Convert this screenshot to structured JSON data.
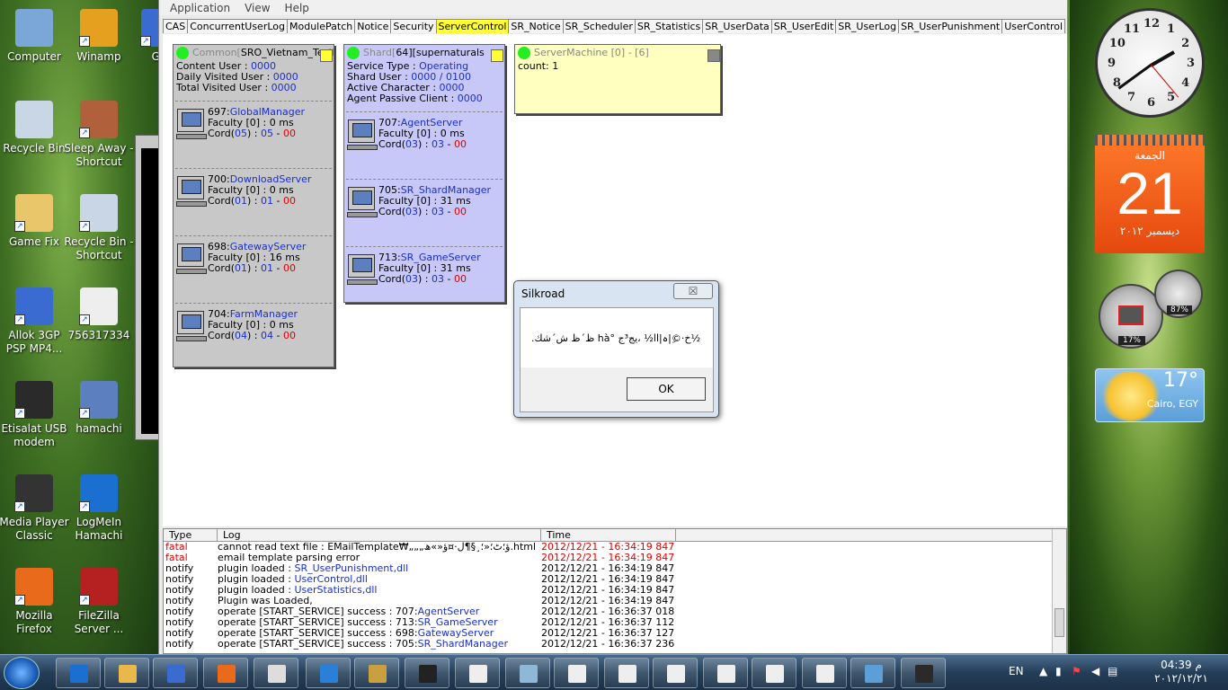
{
  "desktop": {
    "icons": [
      {
        "label": "Computer",
        "color": "#7aa7d8",
        "x": 0
      },
      {
        "label": "Winamp",
        "color": "#e5a020",
        "x": 0
      },
      {
        "label": "GO",
        "color": "#3a6bd0",
        "x": 0
      },
      {
        "label": "Recycle Bin",
        "color": "#c9d6e6",
        "x": 0
      },
      {
        "label": "Sleep Away - Shortcut",
        "color": "#b0603a",
        "x": 0
      },
      {
        "label": "Game Fix",
        "color": "#e9c66a",
        "x": 0
      },
      {
        "label": "Recycle Bin - Shortcut",
        "color": "#c9d6e6",
        "x": 0
      },
      {
        "label": "Allok 3GP PSP MP4...",
        "color": "#3a6bd0",
        "x": 0
      },
      {
        "label": "756317334",
        "color": "#eeeeee",
        "x": 0
      },
      {
        "label": "Etisalat USB modem",
        "color": "#2a2a2a",
        "x": 0
      },
      {
        "label": "hamachi",
        "color": "#5b7fbf",
        "x": 0
      },
      {
        "label": "Media Player Classic",
        "color": "#333333",
        "x": 0
      },
      {
        "label": "LogMeIn Hamachi",
        "color": "#1a6fd0",
        "x": 0
      },
      {
        "label": "Mozilla Firefox",
        "color": "#e86a1a",
        "x": 0
      },
      {
        "label": "FileZilla Server ...",
        "color": "#b52020",
        "x": 0
      }
    ]
  },
  "app": {
    "menu": [
      "Application",
      "View",
      "Help"
    ],
    "tabs": [
      "CAS",
      "ConcurrentUserLog",
      "ModulePatch",
      "Notice",
      "Security",
      "ServerControl",
      "SR_Notice",
      "SR_Scheduler",
      "SR_Statistics",
      "SR_UserData",
      "SR_UserEdit",
      "SR_UserLog",
      "SR_UserPunishment",
      "UserControl"
    ],
    "active_tab": "ServerControl",
    "common": {
      "title": "Common[",
      "title_value": "SRO_Vietnam_TestL",
      "lines": [
        {
          "label": "Content User : ",
          "value": "0000"
        },
        {
          "label": "Daily Visited User : ",
          "value": "0000"
        },
        {
          "label": "Total Visited User : ",
          "value": "0000"
        }
      ],
      "servers": [
        {
          "id": "697:",
          "name": "GlobalManager",
          "faculty": "Faculty [0] : 0 ms",
          "cord_a": "05",
          "cord_b": "05",
          "cord_c": "00"
        },
        {
          "id": "700:",
          "name": "DownloadServer",
          "faculty": "Faculty [0] : 0 ms",
          "cord_a": "01",
          "cord_b": "01",
          "cord_c": "00"
        },
        {
          "id": "698:",
          "name": "GatewayServer",
          "faculty": "Faculty [0] : 16 ms",
          "cord_a": "01",
          "cord_b": "01",
          "cord_c": "00"
        },
        {
          "id": "704:",
          "name": "FarmManager",
          "faculty": "Faculty [0] : 0 ms",
          "cord_a": "04",
          "cord_b": "04",
          "cord_c": "00"
        }
      ]
    },
    "shard": {
      "title": "Shard[",
      "title_num": "64",
      "title_mid": "][",
      "title_value": "supernaturals",
      "lines": [
        {
          "label": "Service Type : ",
          "value": "Operating"
        },
        {
          "label": "Shard User : ",
          "value": "0000 / 0100"
        },
        {
          "label": "Active Character : ",
          "value": "0000"
        },
        {
          "label": "Agent Passive Client : ",
          "value": "0000"
        }
      ],
      "servers": [
        {
          "id": "707:",
          "name": "AgentServer",
          "faculty": "Faculty [0] : 0 ms",
          "cord_a": "03",
          "cord_b": "03",
          "cord_c": "00"
        },
        {
          "id": "705:",
          "name": "SR_ShardManager",
          "faculty": "Faculty [0] : 31 ms",
          "cord_a": "03",
          "cord_b": "03",
          "cord_c": "00"
        },
        {
          "id": "713:",
          "name": "SR_GameServer",
          "faculty": "Faculty [0] : 31 ms",
          "cord_a": "03",
          "cord_b": "03",
          "cord_c": "00"
        }
      ]
    },
    "machine": {
      "title": "ServerMachine [0] - [6]",
      "count": "count: 1"
    },
    "log": {
      "headers": [
        "Type",
        "Log",
        "Time"
      ],
      "rows": [
        {
          "type": "fatal",
          "pre": "cannot read text file : EMailTemplate₩„„„ؤ؛ٹ؛«؛¸§¶لِ·¤ؤ«»ھ.html",
          "link": "",
          "time": "2012/12/21 - 16:34:19 847",
          "red": true
        },
        {
          "type": "fatal",
          "pre": "email template parsing error",
          "link": "",
          "time": "2012/12/21 - 16:34:19 847",
          "red": true
        },
        {
          "type": "notify",
          "pre": "plugin loaded : ",
          "link": "SR_UserPunishment,dll",
          "time": "2012/12/21 - 16:34:19 847",
          "red": false
        },
        {
          "type": "notify",
          "pre": "plugin loaded : ",
          "link": "UserControl,dll",
          "time": "2012/12/21 - 16:34:19 847",
          "red": false
        },
        {
          "type": "notify",
          "pre": "plugin loaded : ",
          "link": "UserStatistics,dll",
          "time": "2012/12/21 - 16:34:19 847",
          "red": false
        },
        {
          "type": "notify",
          "pre": "Plugin was Loaded,",
          "link": "",
          "time": "2012/12/21 - 16:34:19 847",
          "red": false
        },
        {
          "type": "notify",
          "pre": "operate [START_SERVICE] success : 707:",
          "link": "AgentServer",
          "time": "2012/12/21 - 16:36:37 018",
          "red": false
        },
        {
          "type": "notify",
          "pre": "operate [START_SERVICE] success : 713:",
          "link": "SR_GameServer",
          "time": "2012/12/21 - 16:36:37 112",
          "red": false
        },
        {
          "type": "notify",
          "pre": "operate [START_SERVICE] success : 698:",
          "link": "GatewayServer",
          "time": "2012/12/21 - 16:36:37 127",
          "red": false
        },
        {
          "type": "notify",
          "pre": "operate [START_SERVICE] success : 705:",
          "link": "SR_ShardManager",
          "time": "2012/12/21 - 16:36:37 236",
          "red": false
        }
      ]
    }
  },
  "dialog": {
    "title": "Silkroad",
    "close": "☒",
    "message": "½خ·©ِ|ہ|اا½ ،يج³ج °hà ظ´ظ ش´شك.",
    "ok": "OK"
  },
  "gadgets": {
    "clock_numbers": [
      "12",
      "1",
      "2",
      "3",
      "4",
      "5",
      "6",
      "7",
      "8",
      "9",
      "10",
      "11"
    ],
    "cal_day_name": "الجمعة",
    "cal_day": "21",
    "cal_month": "ديسمبر ٢٠١٢",
    "cpu": "17%",
    "ram": "87%",
    "temp": "17°",
    "city": "Cairo, EGY"
  },
  "taskbar": {
    "lang": "EN",
    "time": "04:39 م",
    "date": "٢٠١٢/١٢/٢١"
  },
  "colors": {
    "link": "#1a2fd0",
    "error": "#e00000",
    "active_tab": "#ffff33",
    "common_bg": "#c8c8c8",
    "shard_bg": "#c8c8f8",
    "machine_bg": "#ffffc0"
  }
}
